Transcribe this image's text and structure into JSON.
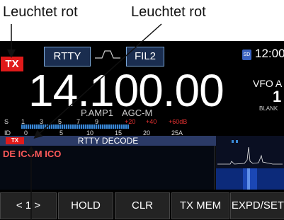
{
  "callouts": {
    "left_label": "Leuchtet rot",
    "right_label": "Leuchtet rot"
  },
  "status": {
    "tx_indicator": "TX",
    "mode": "RTTY",
    "filter": "FIL2",
    "sd_label": "SD",
    "time": "12:00"
  },
  "frequency": {
    "value": "14.100.00",
    "vfo_label": "VFO A",
    "vfo_number": "1",
    "blank_label": "BLANK"
  },
  "settings": {
    "preamp": "P.AMP1",
    "agc": "AGC-M"
  },
  "meter": {
    "s_label": "S",
    "s_scale": [
      "1",
      "3",
      "5",
      "7",
      "9",
      "+20",
      "+40",
      "+60dB"
    ],
    "id_label": "ID",
    "id_scale": [
      "0",
      "5",
      "10",
      "15",
      "20",
      "25A"
    ]
  },
  "decode": {
    "title": "RTTY DECODE",
    "tx_badge": "TX",
    "text": "DE ICOM ICO"
  },
  "softkeys": [
    "< 1 >",
    "HOLD",
    "CLR",
    "TX MEM",
    "EXPD/SET"
  ],
  "colors": {
    "tx_red": "#e01a1a",
    "decode_text": "#ff5a5a",
    "button_border": "#7aa6d6"
  }
}
